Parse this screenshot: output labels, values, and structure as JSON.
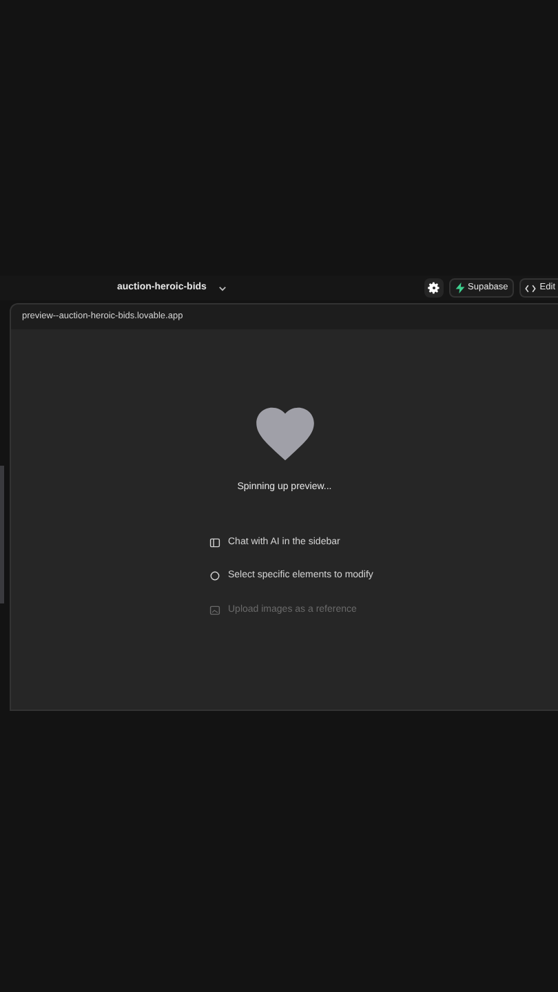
{
  "project": {
    "name": "auction-heroic-bids"
  },
  "toolbar": {
    "supabase": "Supabase",
    "edit": "Edit"
  },
  "preview": {
    "url": "preview--auction-heroic-bids.lovable.app",
    "status": "Spinning up preview...",
    "tips": [
      {
        "kind": "sidebar",
        "label": "Chat with AI in the sidebar",
        "dimmed": false
      },
      {
        "kind": "select",
        "label": "Select specific elements to modify",
        "dimmed": false
      },
      {
        "kind": "image",
        "label": "Upload images as a reference",
        "dimmed": true
      }
    ]
  }
}
